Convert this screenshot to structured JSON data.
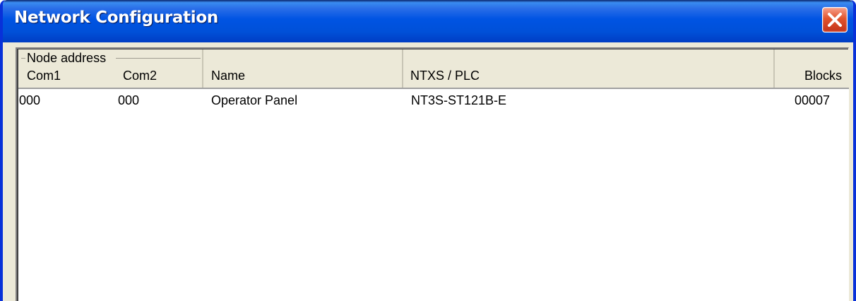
{
  "window": {
    "title": "Network Configuration"
  },
  "list": {
    "group_header": "Node address",
    "columns": {
      "com1": "Com1",
      "com2": "Com2",
      "name": "Name",
      "ntxs_plc": "NTXS / PLC",
      "blocks": "Blocks"
    },
    "rows": [
      {
        "com1": "000",
        "com2": "000",
        "name": "Operator Panel",
        "ntxs_plc": "NT3S-ST121B-E",
        "blocks": "00007"
      }
    ]
  },
  "icons": {
    "close": "close-icon"
  },
  "colors": {
    "titlebar": "#0054e3",
    "close_button": "#e0532c",
    "window_face": "#ece9d8",
    "list_background": "#ffffff"
  }
}
